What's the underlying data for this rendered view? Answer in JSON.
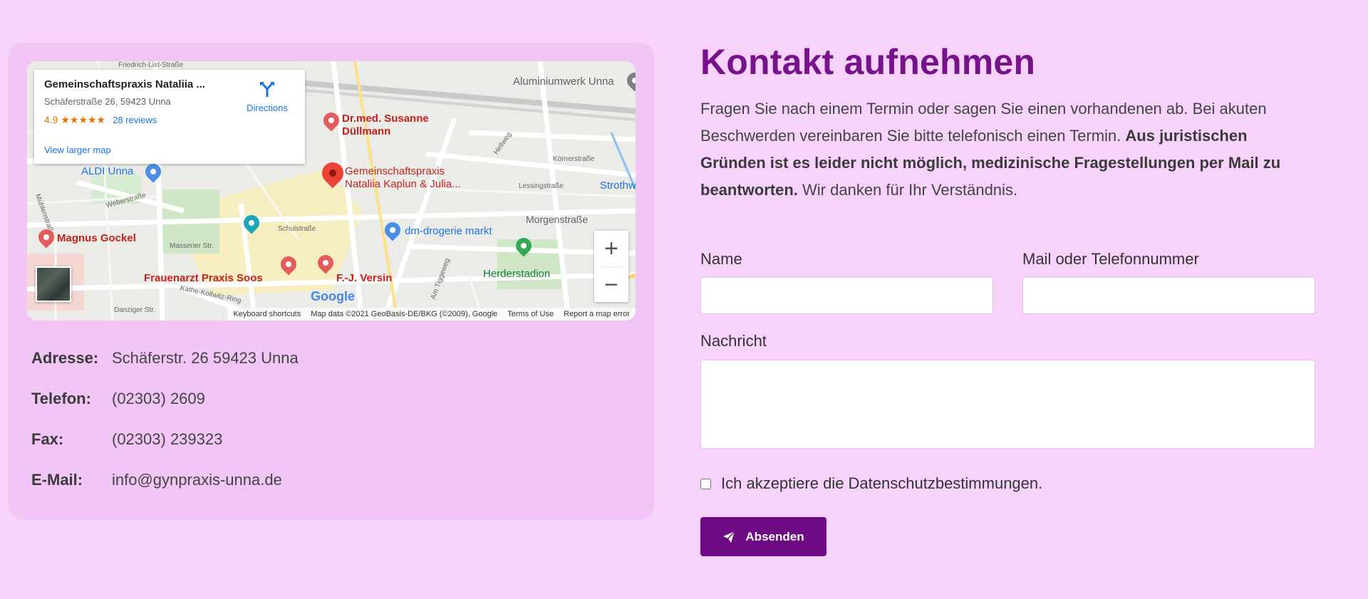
{
  "map": {
    "place_card": {
      "title": "Gemeinschaftspraxis Nataliia ...",
      "address": "Schäferstraße 26, 59423 Unna",
      "rating": "4.9 ★★★★★",
      "reviews": "28 reviews",
      "larger_map": "View larger map",
      "directions": "Directions"
    },
    "labels": {
      "friedrich_list": "Friedrich-List-Straße",
      "aluminiumwerk": "Aluminiumwerk Unna",
      "duellmann_1": "Dr.med. Susanne",
      "duellmann_2": "Düllmann",
      "praxis_1": "Gemeinschaftspraxis",
      "praxis_2": "Nataliia Kaplun & Julia...",
      "aldi": "ALDI Unna",
      "weberstrasse": "Weberstraße",
      "muehlenstrasse": "Mühlenstraße",
      "hellweg": "Hellweg",
      "koernerstrasse": "Körnerstraße",
      "lessingstrasse": "Lessingstraße",
      "strothweg": "Strothw",
      "morgenstrasse": "Morgenstraße",
      "schulstrasse": "Schulstraße",
      "dm": "dm-drogerie markt",
      "gockel": "Magnus Gockel",
      "massener": "Massener Str.",
      "herderstadion": "Herderstadion",
      "soos": "Frauenarzt Praxis Soos",
      "versin": "F.-J. Versin",
      "kollwitz": "Käthe-Kollwitz-Ring",
      "danziger": "Danziger Str.",
      "tiggenweg": "Am Tiggeweg"
    },
    "google": "Google",
    "zoom_in": "+",
    "zoom_out": "−",
    "attribution": {
      "shortcuts": "Keyboard shortcuts",
      "data": "Map data ©2021 GeoBasis-DE/BKG (©2009), Google",
      "terms": "Terms of Use",
      "report": "Report a map error"
    }
  },
  "details": [
    {
      "label": "Adresse:",
      "value": "Schäferstr. 26 59423 Unna"
    },
    {
      "label": "Telefon:",
      "value": "(02303) 2609"
    },
    {
      "label": "Fax:",
      "value": "(02303) 239323"
    },
    {
      "label": "E-Mail:",
      "value": "info@gynpraxis-unna.de"
    }
  ],
  "contact": {
    "title": "Kontakt aufnehmen",
    "intro_plain": "Fragen Sie nach einem Termin oder sagen Sie einen vorhandenen ab. Bei akuten Beschwerden vereinbaren Sie bitte telefonisch einen Termin. ",
    "intro_bold": "Aus juristischen Gründen ist es leider nicht möglich, medizinische Fragestellungen per Mail zu beantworten.",
    "intro_end": " Wir danken für Ihr Verständnis."
  },
  "form": {
    "name_label": "Name",
    "contact_label": "Mail oder Telefonnummer",
    "message_label": "Nachricht",
    "consent": "Ich akzeptiere die Datenschutzbestimmungen.",
    "submit": "Absenden"
  },
  "colors": {
    "background": "#f7d3fb",
    "card": "#f1c5f5",
    "accent": "#75138a",
    "button": "#6e0a83"
  }
}
